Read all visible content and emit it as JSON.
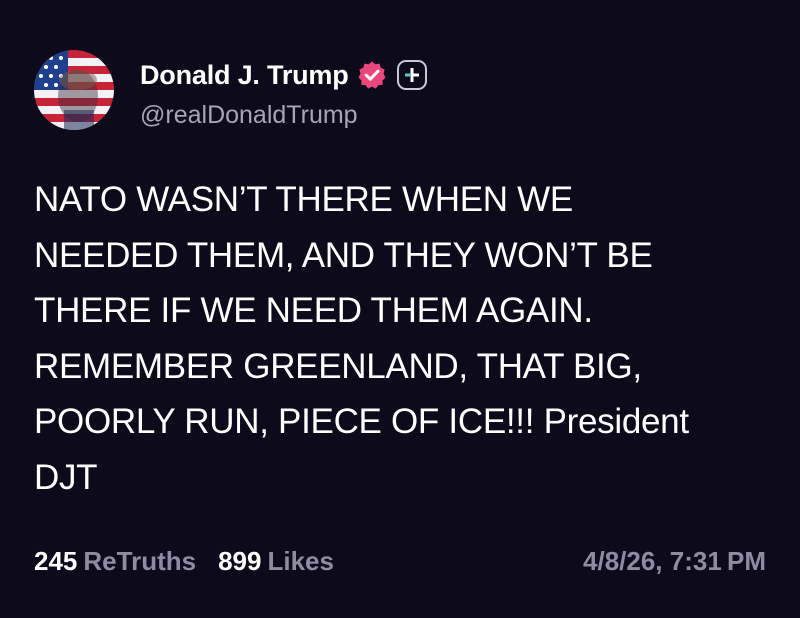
{
  "author": {
    "display_name": "Donald J. Trump",
    "handle": "@realDonaldTrump",
    "verified_color": "#e8467c"
  },
  "post": {
    "lines": [
      "NATO WASN’T THERE WHEN WE",
      "NEEDED THEM, AND THEY WON’T BE",
      "THERE IF WE NEED THEM AGAIN.",
      "REMEMBER GREENLAND, THAT BIG,",
      "POORLY RUN, PIECE OF ICE!!! President",
      "DJT"
    ]
  },
  "stats": {
    "retruths_count": "245",
    "retruths_label": "ReTruths",
    "likes_count": "899",
    "likes_label": "Likes"
  },
  "timestamp": "4/8/26, 7:31 PM",
  "icons": {
    "avatar": "avatar",
    "verified": "verified-badge-icon",
    "plus": "plus-badge-icon"
  }
}
